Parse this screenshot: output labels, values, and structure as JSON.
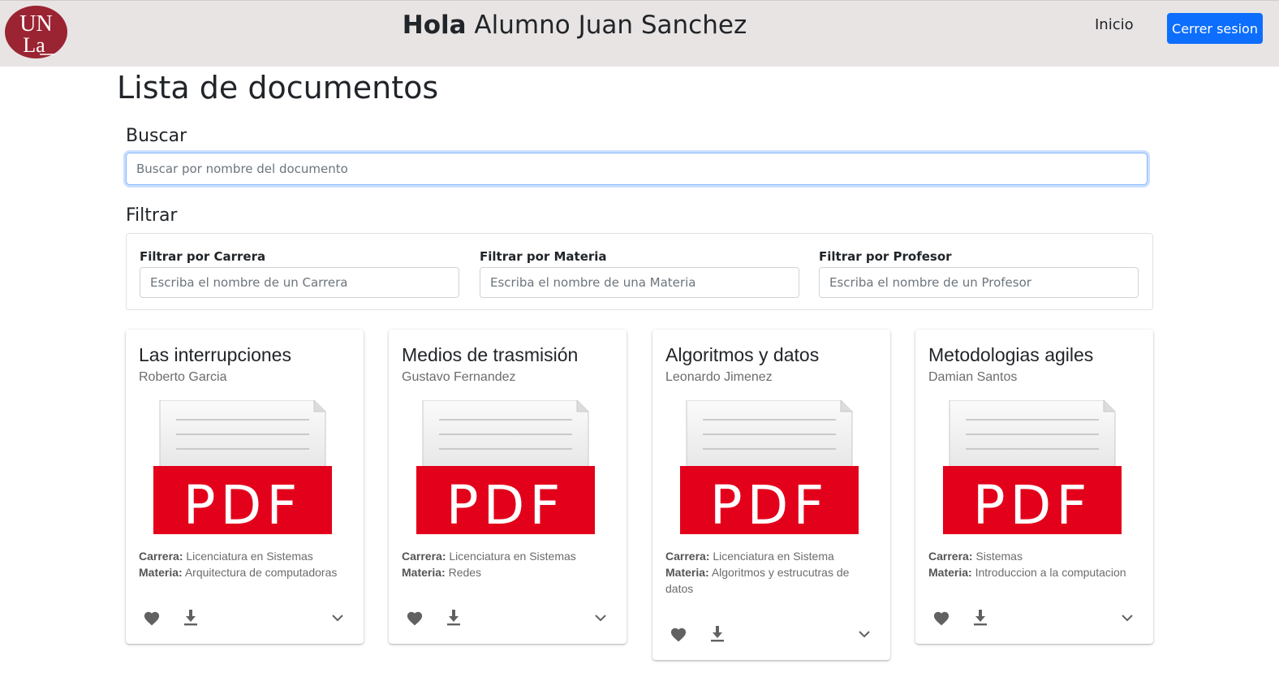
{
  "header": {
    "logo_text_top": "UN",
    "logo_text_bottom": "La",
    "greeting_bold": "Hola",
    "greeting_rest": " Alumno Juan Sanchez",
    "nav_home": "Inicio",
    "logout": "Cerrer sesion",
    "logout_color": "#0d6efd",
    "logo_color": "#9a2432"
  },
  "page": {
    "title": "Lista de documentos",
    "search_label": "Buscar",
    "search_placeholder": "Buscar por nombre del documento",
    "filter_label": "Filtrar"
  },
  "filters": [
    {
      "label": "Filtrar por Carrera",
      "placeholder": "Escriba el nombre de un Carrera"
    },
    {
      "label": "Filtrar por Materia",
      "placeholder": "Escriba el nombre de una Materia"
    },
    {
      "label": "Filtrar por Profesor",
      "placeholder": "Escriba el nombre de un Profesor"
    }
  ],
  "labels": {
    "carrera": "Carrera:",
    "materia": "Materia:",
    "pdf": "PDF"
  },
  "documents": [
    {
      "title": "Las interrupciones",
      "author": "Roberto Garcia",
      "carrera": "Licenciatura en Sistemas",
      "materia": "Arquitectura de computadoras"
    },
    {
      "title": "Medios de trasmisión",
      "author": "Gustavo Fernandez",
      "carrera": "Licenciatura en Sistemas",
      "materia": "Redes"
    },
    {
      "title": "Algoritmos y datos",
      "author": "Leonardo Jimenez",
      "carrera": "Licenciatura en Sistema",
      "materia": "Algoritmos y estrucutras de datos"
    },
    {
      "title": "Metodologias agiles",
      "author": "Damian Santos",
      "carrera": "Sistemas",
      "materia": "Introduccion a la computacion"
    }
  ],
  "icons": {
    "favorite": "heart-icon",
    "download": "download-icon",
    "expand": "chevron-down-icon"
  }
}
